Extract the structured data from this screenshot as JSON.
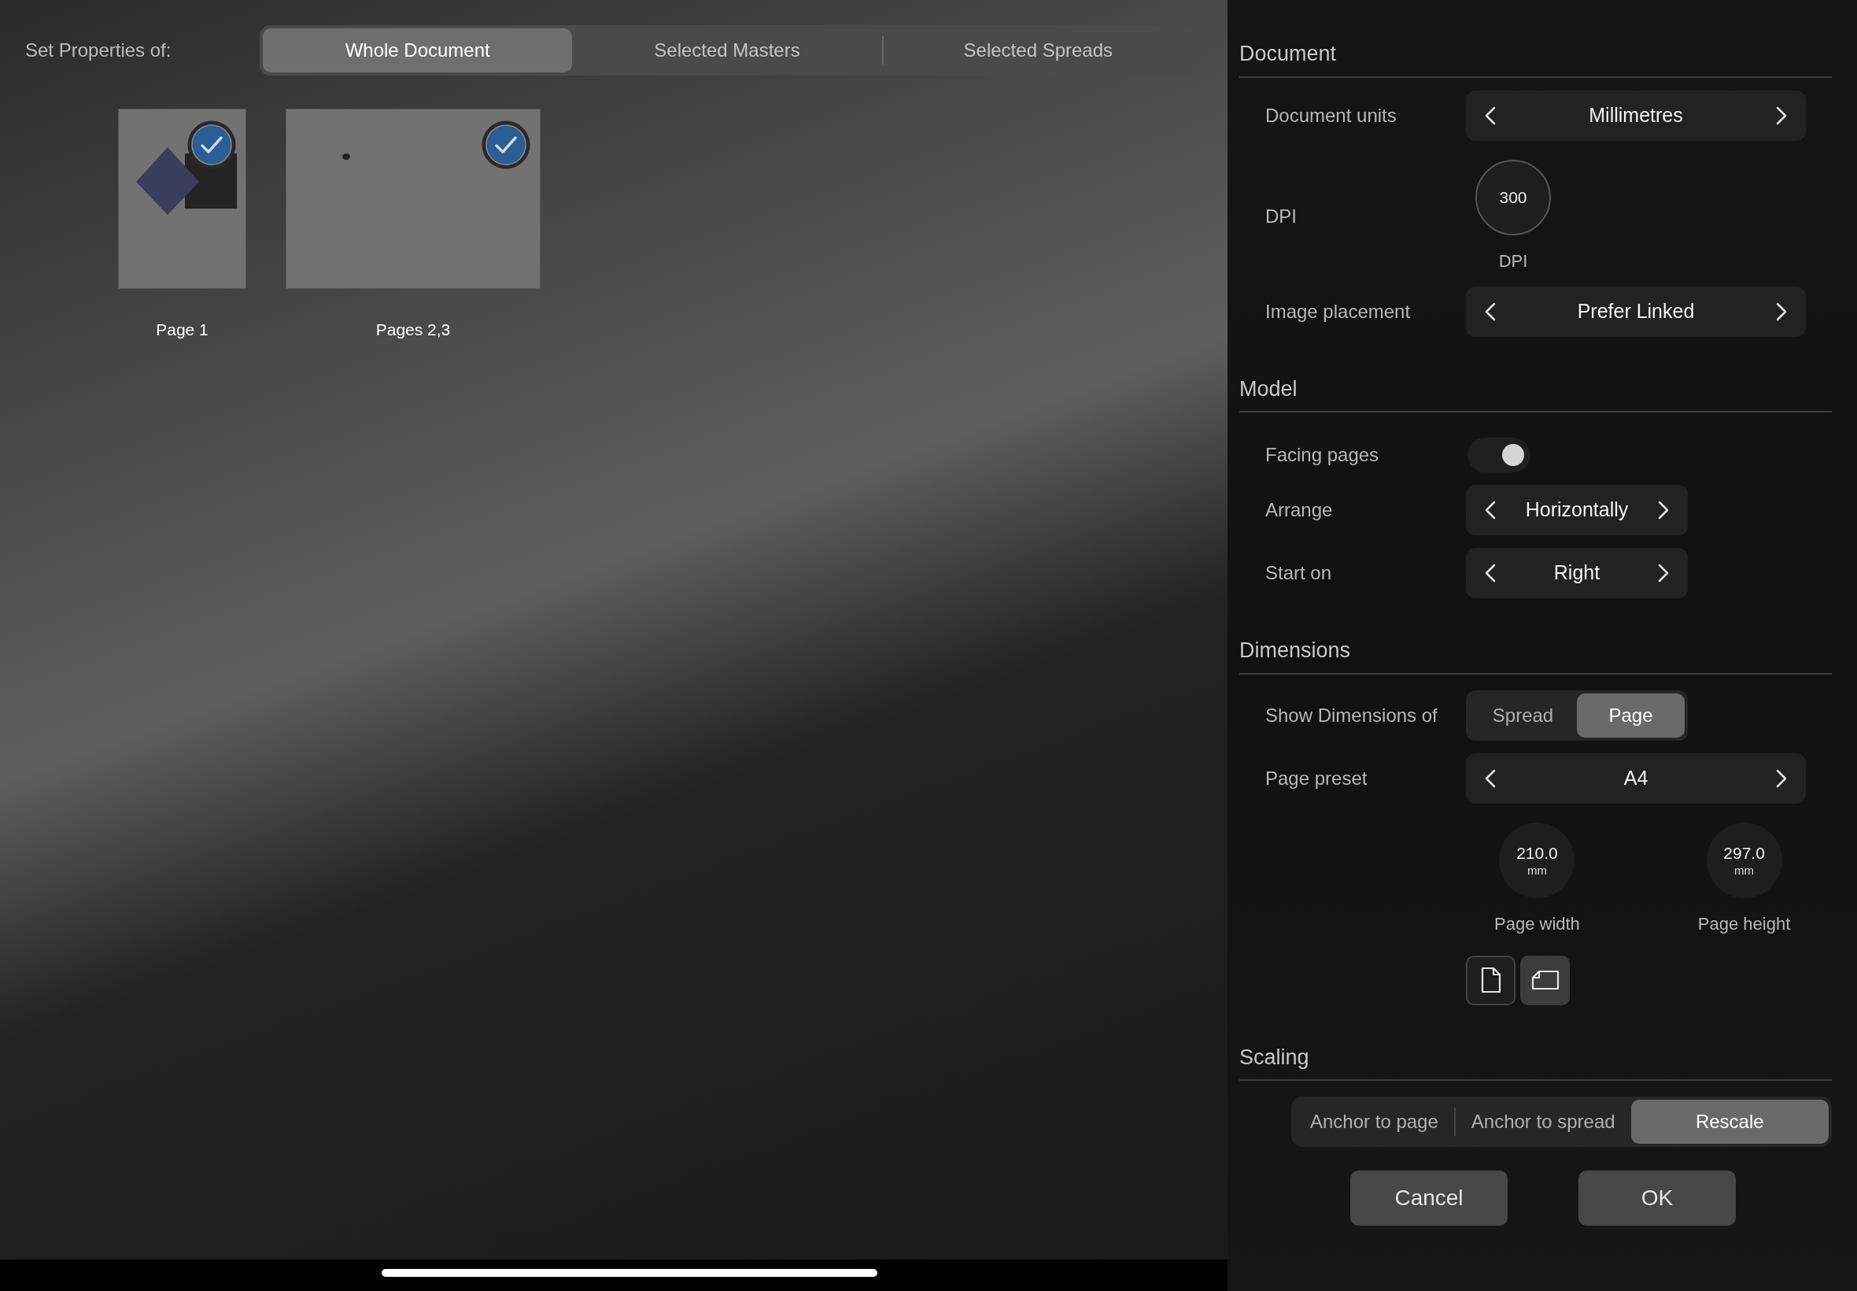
{
  "properties_of": {
    "label": "Set Properties of:",
    "options": [
      {
        "label": "Whole Document",
        "selected": true
      },
      {
        "label": "Selected Masters",
        "selected": false
      },
      {
        "label": "Selected Spreads",
        "selected": false
      }
    ]
  },
  "thumbnails": [
    {
      "kind": "portrait",
      "label": "Page 1",
      "checked": true
    },
    {
      "kind": "spread",
      "label": "Pages 2,3",
      "checked": true
    }
  ],
  "sections": [
    {
      "title": "Document",
      "rows": [
        {
          "kind": "stepper",
          "label": "Document units",
          "value": "Millimetres"
        },
        {
          "kind": "dial",
          "label": "DPI",
          "value": "300",
          "caption": "DPI"
        },
        {
          "kind": "stepper",
          "label": "Image placement",
          "value": "Prefer Linked"
        }
      ]
    },
    {
      "title": "Model",
      "rows": [
        {
          "kind": "toggle",
          "label": "Facing pages",
          "on": true
        },
        {
          "kind": "picker",
          "label": "Arrange",
          "value": "Horizontally"
        },
        {
          "kind": "picker",
          "label": "Start on",
          "value": "Right"
        }
      ]
    },
    {
      "title": "Dimensions",
      "rows": [
        {
          "kind": "segments",
          "label": "Show Dimensions of",
          "options": [
            {
              "label": "Spread",
              "selected": false
            },
            {
              "label": "Page",
              "selected": true
            }
          ]
        },
        {
          "kind": "stepper",
          "label": "Page preset",
          "value": "A4"
        },
        {
          "kind": "dials",
          "dials": [
            {
              "value": "210.0",
              "unit": "mm",
              "caption": "Page width"
            },
            {
              "value": "297.0",
              "unit": "mm",
              "caption": "Page height"
            }
          ]
        },
        {
          "kind": "orientation",
          "options": [
            {
              "kind": "portrait",
              "selected": true
            },
            {
              "kind": "landscape",
              "selected": false
            }
          ]
        }
      ]
    },
    {
      "title": "Scaling",
      "rows": [
        {
          "kind": "wide_segments",
          "options": [
            {
              "label": "Anchor to page",
              "selected": false
            },
            {
              "label": "Anchor to spread",
              "selected": false
            },
            {
              "label": "Rescale",
              "selected": true
            }
          ]
        }
      ]
    }
  ],
  "buttons": [
    "Cancel",
    "OK"
  ]
}
